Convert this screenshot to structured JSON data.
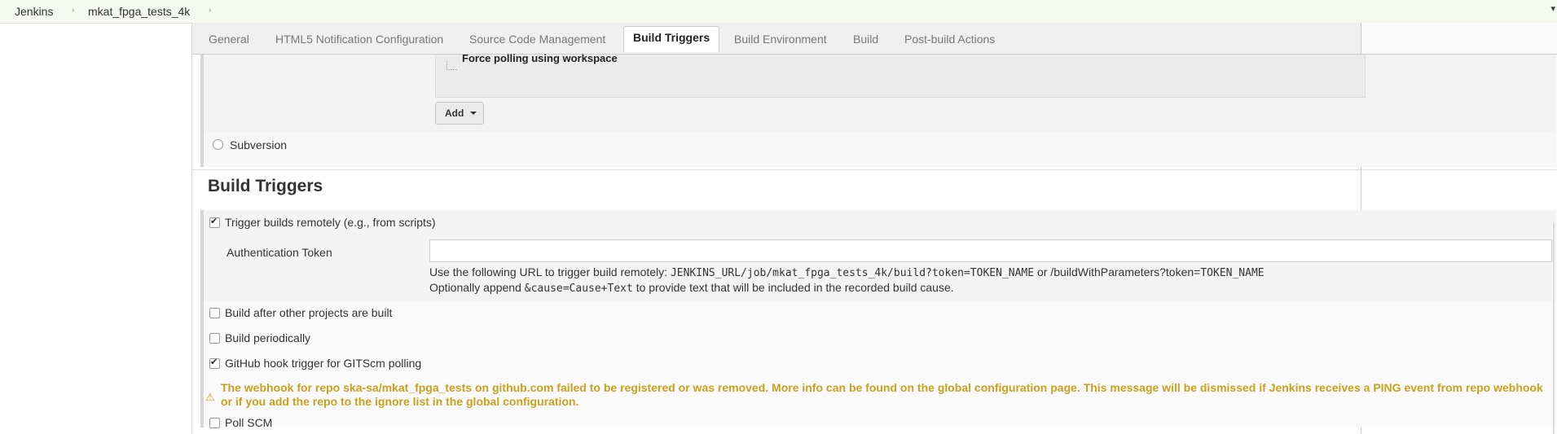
{
  "breadcrumb": {
    "items": [
      "Jenkins",
      "mkat_fpga_tests_4k"
    ],
    "separator": "›"
  },
  "tabs": [
    {
      "label": "General",
      "active": false
    },
    {
      "label": "HTML5 Notification Configuration",
      "active": false
    },
    {
      "label": "Source Code Management",
      "active": false
    },
    {
      "label": "Build Triggers",
      "active": true
    },
    {
      "label": "Build Environment",
      "active": false
    },
    {
      "label": "Build",
      "active": false
    },
    {
      "label": "Post-build Actions",
      "active": false
    }
  ],
  "scm": {
    "clipped_behaviour_label": "Force polling using workspace",
    "add_button_label": "Add",
    "subversion_label": "Subversion"
  },
  "build_triggers": {
    "title": "Build Triggers",
    "trigger_remotely": {
      "label": "Trigger builds remotely (e.g., from scripts)",
      "checked": true
    },
    "auth_token": {
      "label": "Authentication Token",
      "value": "",
      "help_line1_prefix": "Use the following URL to trigger build remotely: ",
      "help_line1_url": "JENKINS_URL/job/mkat_fpga_tests_4k/build?token=TOKEN_NAME",
      "help_line1_mid": " or /buildWithParameters?token=",
      "help_line1_token": "TOKEN_NAME",
      "help_line2_prefix": "Optionally append ",
      "help_line2_code": "&cause=Cause+Text",
      "help_line2_suffix": " to provide text that will be included in the recorded build cause."
    },
    "after_other_projects": {
      "label": "Build after other projects are built",
      "checked": false
    },
    "periodically": {
      "label": "Build periodically",
      "checked": false
    },
    "github_hook": {
      "label": "GitHub hook trigger for GITScm polling",
      "checked": true
    },
    "webhook_warning": "The webhook for repo ska-sa/mkat_fpga_tests on github.com failed to be registered or was removed. More info can be found on the global configuration page. This message will be dismissed if Jenkins receives a PING event from repo webhook or if you add the repo to the ignore list in the global configuration.",
    "poll_scm": {
      "label": "Poll SCM",
      "checked": false
    }
  },
  "colors": {
    "warning": "#c9a11d",
    "breadcrumb_bg": "#f5f8f0",
    "tabbar_bg": "#f0f0f0"
  },
  "icons": {
    "warning": "warning-icon",
    "breadcrumb_separator": "chevron-right-icon",
    "dropdown": "caret-down-icon"
  }
}
